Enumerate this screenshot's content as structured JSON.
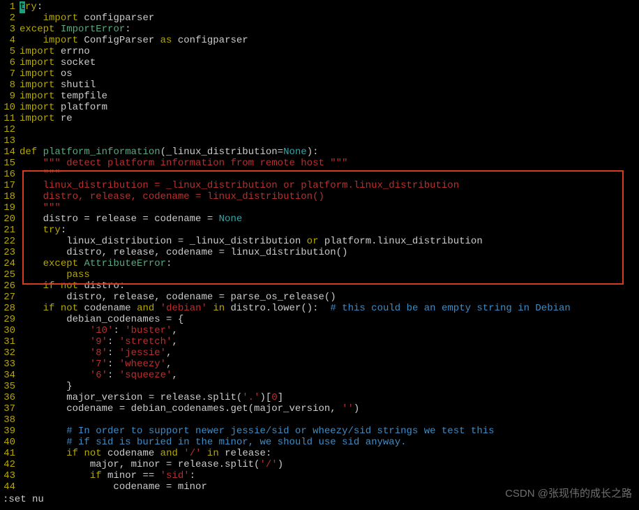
{
  "status": ":set nu",
  "watermark": "CSDN @张现伟的成长之路",
  "lines": [
    {
      "n": "1",
      "tokens": [
        {
          "t": "",
          "c": "cursor"
        },
        {
          "t": "ry",
          "c": "kw"
        },
        {
          "t": ":",
          "c": "op"
        }
      ]
    },
    {
      "n": "2",
      "tokens": [
        {
          "t": "    ",
          "c": "op"
        },
        {
          "t": "import",
          "c": "kw"
        },
        {
          "t": " configparser",
          "c": "op"
        }
      ]
    },
    {
      "n": "3",
      "tokens": [
        {
          "t": "except",
          "c": "kw"
        },
        {
          "t": " ",
          "c": "op"
        },
        {
          "t": "ImportError",
          "c": "kw2"
        },
        {
          "t": ":",
          "c": "op"
        }
      ]
    },
    {
      "n": "4",
      "tokens": [
        {
          "t": "    ",
          "c": "op"
        },
        {
          "t": "import",
          "c": "kw"
        },
        {
          "t": " ConfigParser ",
          "c": "op"
        },
        {
          "t": "as",
          "c": "kw"
        },
        {
          "t": " configparser",
          "c": "op"
        }
      ]
    },
    {
      "n": "5",
      "tokens": [
        {
          "t": "import",
          "c": "kw"
        },
        {
          "t": " errno",
          "c": "op"
        }
      ]
    },
    {
      "n": "6",
      "tokens": [
        {
          "t": "import",
          "c": "kw"
        },
        {
          "t": " socket",
          "c": "op"
        }
      ]
    },
    {
      "n": "7",
      "tokens": [
        {
          "t": "import",
          "c": "kw"
        },
        {
          "t": " os",
          "c": "op"
        }
      ]
    },
    {
      "n": "8",
      "tokens": [
        {
          "t": "import",
          "c": "kw"
        },
        {
          "t": " shutil",
          "c": "op"
        }
      ]
    },
    {
      "n": "9",
      "tokens": [
        {
          "t": "import",
          "c": "kw"
        },
        {
          "t": " tempfile",
          "c": "op"
        }
      ]
    },
    {
      "n": "10",
      "tokens": [
        {
          "t": "import",
          "c": "kw"
        },
        {
          "t": " platform",
          "c": "op"
        }
      ]
    },
    {
      "n": "11",
      "tokens": [
        {
          "t": "import",
          "c": "kw"
        },
        {
          "t": " re",
          "c": "op"
        }
      ]
    },
    {
      "n": "12",
      "tokens": []
    },
    {
      "n": "13",
      "tokens": []
    },
    {
      "n": "14",
      "tokens": [
        {
          "t": "def",
          "c": "kw"
        },
        {
          "t": " ",
          "c": "op"
        },
        {
          "t": "platform_information",
          "c": "kw2"
        },
        {
          "t": "(_linux_distribution=",
          "c": "op"
        },
        {
          "t": "None",
          "c": "none"
        },
        {
          "t": "):",
          "c": "op"
        }
      ]
    },
    {
      "n": "15",
      "tokens": [
        {
          "t": "    ",
          "c": "op"
        },
        {
          "t": "\"\"\" detect platform information from remote host \"\"\"",
          "c": "dim"
        }
      ]
    },
    {
      "n": "16",
      "tokens": [
        {
          "t": "    ",
          "c": "op"
        },
        {
          "t": "\"\"\"",
          "c": "dim"
        }
      ]
    },
    {
      "n": "17",
      "tokens": [
        {
          "t": "    ",
          "c": "op"
        },
        {
          "t": "linux_distribution = _linux_distribution or platform.linux_distribution",
          "c": "dim"
        }
      ]
    },
    {
      "n": "18",
      "tokens": [
        {
          "t": "    ",
          "c": "op"
        },
        {
          "t": "distro, release, codename = linux_distribution()",
          "c": "dim"
        }
      ]
    },
    {
      "n": "19",
      "tokens": [
        {
          "t": "    ",
          "c": "op"
        },
        {
          "t": "\"\"\"",
          "c": "dim"
        }
      ]
    },
    {
      "n": "20",
      "tokens": [
        {
          "t": "    distro = release = codename = ",
          "c": "op"
        },
        {
          "t": "None",
          "c": "none"
        }
      ]
    },
    {
      "n": "21",
      "tokens": [
        {
          "t": "    ",
          "c": "op"
        },
        {
          "t": "try",
          "c": "kw"
        },
        {
          "t": ":",
          "c": "op"
        }
      ]
    },
    {
      "n": "22",
      "tokens": [
        {
          "t": "        linux_distribution = _linux_distribution ",
          "c": "op"
        },
        {
          "t": "or",
          "c": "kw"
        },
        {
          "t": " platform.linux_distribution",
          "c": "op"
        }
      ]
    },
    {
      "n": "23",
      "tokens": [
        {
          "t": "        distro, release, codename = linux_distribution()",
          "c": "op"
        }
      ]
    },
    {
      "n": "24",
      "tokens": [
        {
          "t": "    ",
          "c": "op"
        },
        {
          "t": "except",
          "c": "kw"
        },
        {
          "t": " ",
          "c": "op"
        },
        {
          "t": "AttributeError",
          "c": "kw2"
        },
        {
          "t": ":",
          "c": "op"
        }
      ]
    },
    {
      "n": "25",
      "tokens": [
        {
          "t": "        ",
          "c": "op"
        },
        {
          "t": "pass",
          "c": "kw"
        }
      ]
    },
    {
      "n": "26",
      "tokens": [
        {
          "t": "    ",
          "c": "op"
        },
        {
          "t": "if",
          "c": "kw"
        },
        {
          "t": " ",
          "c": "op"
        },
        {
          "t": "not",
          "c": "kw"
        },
        {
          "t": " distro:",
          "c": "op"
        }
      ]
    },
    {
      "n": "27",
      "tokens": [
        {
          "t": "        distro, release, codename = parse_os_release()",
          "c": "op"
        }
      ]
    },
    {
      "n": "28",
      "tokens": [
        {
          "t": "    ",
          "c": "op"
        },
        {
          "t": "if",
          "c": "kw"
        },
        {
          "t": " ",
          "c": "op"
        },
        {
          "t": "not",
          "c": "kw"
        },
        {
          "t": " codename ",
          "c": "op"
        },
        {
          "t": "and",
          "c": "kw"
        },
        {
          "t": " ",
          "c": "op"
        },
        {
          "t": "'debian'",
          "c": "str"
        },
        {
          "t": " ",
          "c": "op"
        },
        {
          "t": "in",
          "c": "kw"
        },
        {
          "t": " distro.lower():  ",
          "c": "op"
        },
        {
          "t": "# this could be an empty string in Debian",
          "c": "com"
        }
      ]
    },
    {
      "n": "29",
      "tokens": [
        {
          "t": "        debian_codenames = {",
          "c": "op"
        }
      ]
    },
    {
      "n": "30",
      "tokens": [
        {
          "t": "            ",
          "c": "op"
        },
        {
          "t": "'10'",
          "c": "str"
        },
        {
          "t": ": ",
          "c": "op"
        },
        {
          "t": "'buster'",
          "c": "str"
        },
        {
          "t": ",",
          "c": "op"
        }
      ]
    },
    {
      "n": "31",
      "tokens": [
        {
          "t": "            ",
          "c": "op"
        },
        {
          "t": "'9'",
          "c": "str"
        },
        {
          "t": ": ",
          "c": "op"
        },
        {
          "t": "'stretch'",
          "c": "str"
        },
        {
          "t": ",",
          "c": "op"
        }
      ]
    },
    {
      "n": "32",
      "tokens": [
        {
          "t": "            ",
          "c": "op"
        },
        {
          "t": "'8'",
          "c": "str"
        },
        {
          "t": ": ",
          "c": "op"
        },
        {
          "t": "'jessie'",
          "c": "str"
        },
        {
          "t": ",",
          "c": "op"
        }
      ]
    },
    {
      "n": "33",
      "tokens": [
        {
          "t": "            ",
          "c": "op"
        },
        {
          "t": "'7'",
          "c": "str"
        },
        {
          "t": ": ",
          "c": "op"
        },
        {
          "t": "'wheezy'",
          "c": "str"
        },
        {
          "t": ",",
          "c": "op"
        }
      ]
    },
    {
      "n": "34",
      "tokens": [
        {
          "t": "            ",
          "c": "op"
        },
        {
          "t": "'6'",
          "c": "str"
        },
        {
          "t": ": ",
          "c": "op"
        },
        {
          "t": "'squeeze'",
          "c": "str"
        },
        {
          "t": ",",
          "c": "op"
        }
      ]
    },
    {
      "n": "35",
      "tokens": [
        {
          "t": "        }",
          "c": "op"
        }
      ]
    },
    {
      "n": "36",
      "tokens": [
        {
          "t": "        major_version = release.split(",
          "c": "op"
        },
        {
          "t": "'.'",
          "c": "str"
        },
        {
          "t": ")[",
          "c": "op"
        },
        {
          "t": "0",
          "c": "str"
        },
        {
          "t": "]",
          "c": "op"
        }
      ]
    },
    {
      "n": "37",
      "tokens": [
        {
          "t": "        codename = debian_codenames.get(major_version, ",
          "c": "op"
        },
        {
          "t": "''",
          "c": "str"
        },
        {
          "t": ")",
          "c": "op"
        }
      ]
    },
    {
      "n": "38",
      "tokens": []
    },
    {
      "n": "39",
      "tokens": [
        {
          "t": "        ",
          "c": "op"
        },
        {
          "t": "# In order to support newer jessie/sid or wheezy/sid strings we test this",
          "c": "com"
        }
      ]
    },
    {
      "n": "40",
      "tokens": [
        {
          "t": "        ",
          "c": "op"
        },
        {
          "t": "# if sid is buried in the minor, we should use sid anyway.",
          "c": "com"
        }
      ]
    },
    {
      "n": "41",
      "tokens": [
        {
          "t": "        ",
          "c": "op"
        },
        {
          "t": "if",
          "c": "kw"
        },
        {
          "t": " ",
          "c": "op"
        },
        {
          "t": "not",
          "c": "kw"
        },
        {
          "t": " codename ",
          "c": "op"
        },
        {
          "t": "and",
          "c": "kw"
        },
        {
          "t": " ",
          "c": "op"
        },
        {
          "t": "'/'",
          "c": "str"
        },
        {
          "t": " ",
          "c": "op"
        },
        {
          "t": "in",
          "c": "kw"
        },
        {
          "t": " release:",
          "c": "op"
        }
      ]
    },
    {
      "n": "42",
      "tokens": [
        {
          "t": "            major, minor = release.split(",
          "c": "op"
        },
        {
          "t": "'/'",
          "c": "str"
        },
        {
          "t": ")",
          "c": "op"
        }
      ]
    },
    {
      "n": "43",
      "tokens": [
        {
          "t": "            ",
          "c": "op"
        },
        {
          "t": "if",
          "c": "kw"
        },
        {
          "t": " minor == ",
          "c": "op"
        },
        {
          "t": "'sid'",
          "c": "str"
        },
        {
          "t": ":",
          "c": "op"
        }
      ]
    },
    {
      "n": "44",
      "tokens": [
        {
          "t": "                codename = minor",
          "c": "op"
        }
      ]
    }
  ]
}
